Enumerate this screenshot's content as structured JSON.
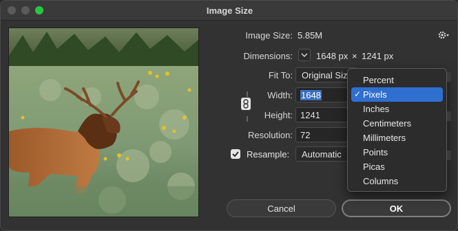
{
  "window": {
    "title": "Image Size"
  },
  "fields": {
    "image_size_label": "Image Size:",
    "image_size_value": "5.85M",
    "dimensions_label": "Dimensions:",
    "dimensions_width": "1648 px",
    "dimensions_sep": "×",
    "dimensions_height": "1241 px",
    "fit_to_label": "Fit To:",
    "fit_to_value": "Original Size",
    "width_label": "Width:",
    "width_value": "1648",
    "height_label": "Height:",
    "height_value": "1241",
    "resolution_label": "Resolution:",
    "resolution_value": "72",
    "resample_label": "Resample:",
    "resample_value": "Automatic"
  },
  "unit_menu": {
    "items": [
      "Percent",
      "Pixels",
      "Inches",
      "Centimeters",
      "Millimeters",
      "Points",
      "Picas",
      "Columns"
    ],
    "selected": "Pixels",
    "check_glyph": "✓"
  },
  "buttons": {
    "cancel": "Cancel",
    "ok": "OK"
  },
  "icons": {
    "gear": "gear-icon",
    "link": "chain-link-icon",
    "chevron": "chevron-down-icon",
    "checkbox": "checkmark-icon"
  },
  "colors": {
    "accent": "#2f6fcf",
    "selection": "#3b6fbf",
    "green": "#29c540"
  }
}
